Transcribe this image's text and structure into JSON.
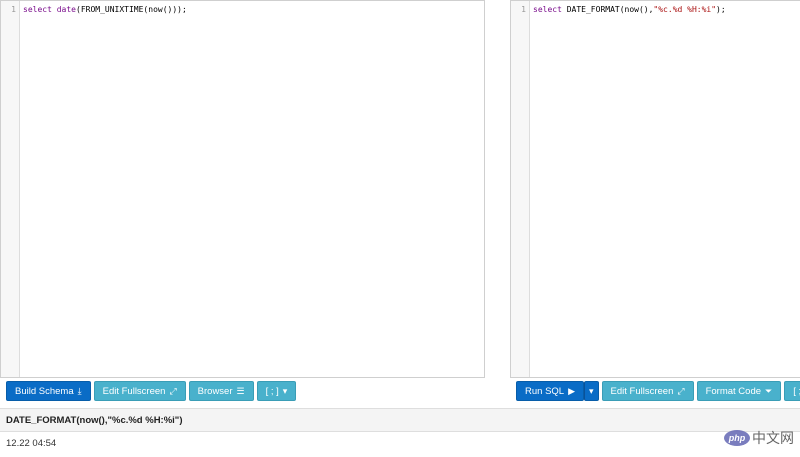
{
  "left_editor": {
    "line_number": "1",
    "code": {
      "kw1": "select",
      "sp1": " ",
      "kw2": "date",
      "rest": "(FROM_UNIXTIME(now()));"
    }
  },
  "right_editor": {
    "line_number": "1",
    "code": {
      "kw1": "select",
      "mid": " DATE_FORMAT(now(),",
      "str": "\"%c.%d %H:%i\"",
      "end": ");"
    }
  },
  "left_toolbar": {
    "build_schema": "Build Schema",
    "edit_fullscreen": "Edit Fullscreen",
    "browser": "Browser",
    "delimiter": "[ ; ]"
  },
  "right_toolbar": {
    "run_sql": "Run SQL",
    "edit_fullscreen": "Edit Fullscreen",
    "format_code": "Format Code",
    "delimiter": "[ ; ]"
  },
  "results": {
    "column": "DATE_FORMAT(now(),\"%c.%d %H:%i\")",
    "value": "12.22 04:54"
  },
  "watermark": {
    "badge": "php",
    "text": "中文网"
  }
}
